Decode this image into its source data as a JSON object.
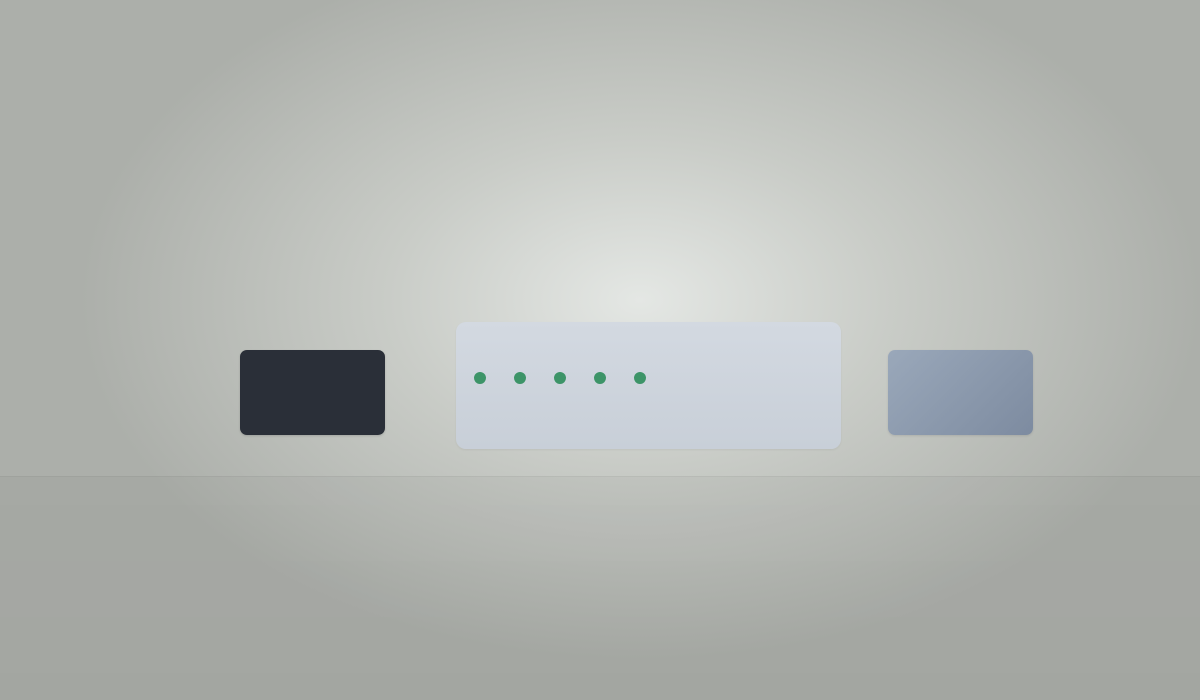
{
  "panel": {
    "masked_characters": 5,
    "dot_color": "#3d9468"
  },
  "colors": {
    "dark_tile": "#2a2f38",
    "panel": "#cdd4dd",
    "slate_tile": "#8998ad"
  }
}
